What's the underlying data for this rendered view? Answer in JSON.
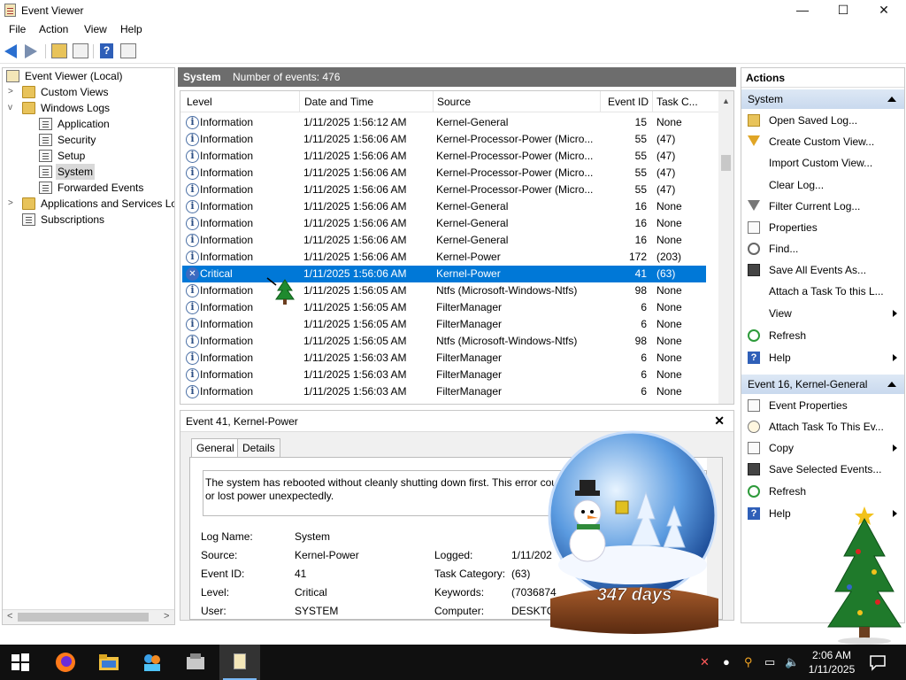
{
  "window": {
    "title": "Event Viewer",
    "controls": {
      "minimize": "—",
      "maximize": "☐",
      "close": "✕"
    }
  },
  "menu": [
    "File",
    "Action",
    "View",
    "Help"
  ],
  "tree": {
    "root": "Event Viewer (Local)",
    "custom_views": "Custom Views",
    "windows_logs": "Windows Logs",
    "logs": [
      "Application",
      "Security",
      "Setup",
      "System",
      "Forwarded Events"
    ],
    "apps_services": "Applications and Services Lo",
    "subscriptions": "Subscriptions"
  },
  "center": {
    "log_name": "System",
    "count_text": "Number of events: 476",
    "columns": [
      "Level",
      "Date and Time",
      "Source",
      "Event ID",
      "Task C..."
    ],
    "rows": [
      {
        "level": "Information",
        "date": "1/11/2025 1:56:12 AM",
        "source": "Kernel-General",
        "id": "15",
        "task": "None"
      },
      {
        "level": "Information",
        "date": "1/11/2025 1:56:06 AM",
        "source": "Kernel-Processor-Power (Micro...",
        "id": "55",
        "task": "(47)"
      },
      {
        "level": "Information",
        "date": "1/11/2025 1:56:06 AM",
        "source": "Kernel-Processor-Power (Micro...",
        "id": "55",
        "task": "(47)"
      },
      {
        "level": "Information",
        "date": "1/11/2025 1:56:06 AM",
        "source": "Kernel-Processor-Power (Micro...",
        "id": "55",
        "task": "(47)"
      },
      {
        "level": "Information",
        "date": "1/11/2025 1:56:06 AM",
        "source": "Kernel-Processor-Power (Micro...",
        "id": "55",
        "task": "(47)"
      },
      {
        "level": "Information",
        "date": "1/11/2025 1:56:06 AM",
        "source": "Kernel-General",
        "id": "16",
        "task": "None"
      },
      {
        "level": "Information",
        "date": "1/11/2025 1:56:06 AM",
        "source": "Kernel-General",
        "id": "16",
        "task": "None"
      },
      {
        "level": "Information",
        "date": "1/11/2025 1:56:06 AM",
        "source": "Kernel-General",
        "id": "16",
        "task": "None"
      },
      {
        "level": "Information",
        "date": "1/11/2025 1:56:06 AM",
        "source": "Kernel-Power",
        "id": "172",
        "task": "(203)"
      },
      {
        "level": "Critical",
        "date": "1/11/2025 1:56:06 AM",
        "source": "Kernel-Power",
        "id": "41",
        "task": "(63)"
      },
      {
        "level": "Information",
        "date": "1/11/2025 1:56:05 AM",
        "source": "Ntfs (Microsoft-Windows-Ntfs)",
        "id": "98",
        "task": "None"
      },
      {
        "level": "Information",
        "date": "1/11/2025 1:56:05 AM",
        "source": "FilterManager",
        "id": "6",
        "task": "None"
      },
      {
        "level": "Information",
        "date": "1/11/2025 1:56:05 AM",
        "source": "FilterManager",
        "id": "6",
        "task": "None"
      },
      {
        "level": "Information",
        "date": "1/11/2025 1:56:05 AM",
        "source": "Ntfs (Microsoft-Windows-Ntfs)",
        "id": "98",
        "task": "None"
      },
      {
        "level": "Information",
        "date": "1/11/2025 1:56:03 AM",
        "source": "FilterManager",
        "id": "6",
        "task": "None"
      },
      {
        "level": "Information",
        "date": "1/11/2025 1:56:03 AM",
        "source": "FilterManager",
        "id": "6",
        "task": "None"
      },
      {
        "level": "Information",
        "date": "1/11/2025 1:56:03 AM",
        "source": "FilterManager",
        "id": "6",
        "task": "None"
      }
    ]
  },
  "detail": {
    "title": "Event 41, Kernel-Power",
    "close": "✕",
    "tabs": [
      "General",
      "Details"
    ],
    "message": "The system has rebooted without cleanly shutting down first. This error cou stopped responding, crashed, or lost power unexpectedly.",
    "labels": [
      "Log Name:",
      "Source:",
      "Event ID:",
      "Level:",
      "User:"
    ],
    "values": [
      "System",
      "Kernel-Power",
      "41",
      "Critical",
      "SYSTEM"
    ],
    "labels2": [
      "Logged:",
      "Task Category:",
      "Keywords:",
      "Computer:"
    ],
    "values2": [
      "1/11/202",
      "(63)",
      "(7036874",
      "DESKTO"
    ]
  },
  "actions": {
    "header": "Actions",
    "section1": "System",
    "items1": [
      "Open Saved Log...",
      "Create Custom View...",
      "Import Custom View...",
      "Clear Log...",
      "Filter Current Log...",
      "Properties",
      "Find...",
      "Save All Events As...",
      "Attach a Task To this L...",
      "View",
      "Refresh",
      "Help"
    ],
    "section2": "Event 16, Kernel-General",
    "items2": [
      "Event Properties",
      "Attach Task To This Ev...",
      "Copy",
      "Save Selected Events...",
      "Refresh",
      "Help"
    ]
  },
  "decoration": {
    "days_text": "347 days"
  },
  "taskbar": {
    "time": "2:06 AM",
    "date": "1/11/2025"
  },
  "colors": {
    "selection": "#0078d7",
    "section_header": "#c9d9ee",
    "taskbar": "#101010"
  }
}
